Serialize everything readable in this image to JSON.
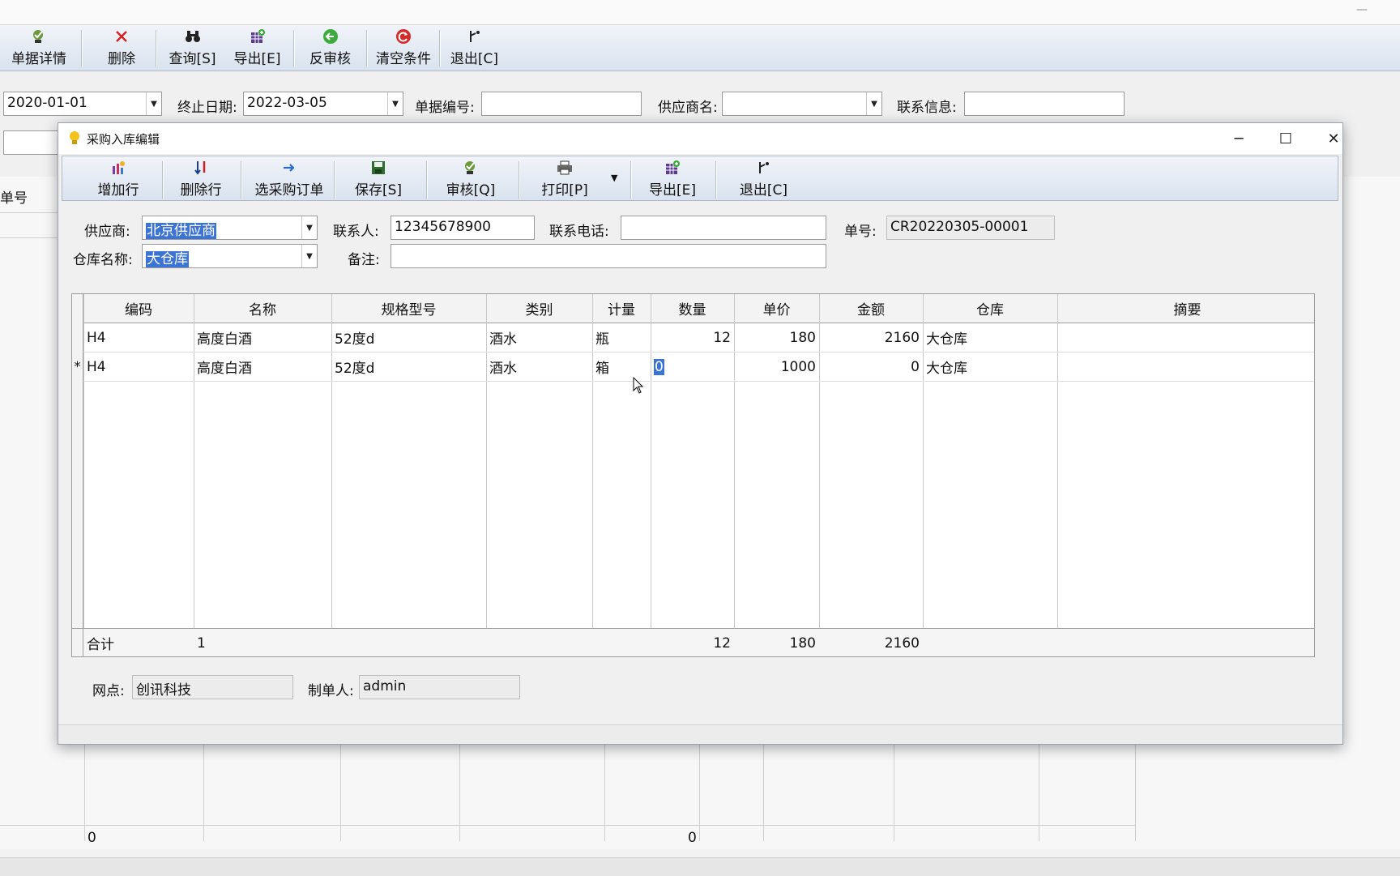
{
  "bg": {
    "toolbar": [
      {
        "label": "单据详情",
        "icon": "approve-icon"
      },
      {
        "label": "删除",
        "icon": "delete-x-icon"
      },
      {
        "label": "查询[S]",
        "icon": "binoculars-icon"
      },
      {
        "label": "导出[E]",
        "icon": "export-grid-icon"
      },
      {
        "label": "反审核",
        "icon": "green-arrow-icon"
      },
      {
        "label": "清空条件",
        "icon": "red-refresh-icon"
      },
      {
        "label": "退出[C]",
        "icon": "exit-icon"
      }
    ],
    "filters": {
      "start_date": "2020-01-01",
      "end_date_label": "终止日期:",
      "end_date": "2022-03-05",
      "doc_no_label": "单据编号:",
      "doc_no": "",
      "supplier_label": "供应商名:",
      "supplier": "",
      "contact_label": "联系信息:",
      "contact": ""
    },
    "grid_first_header": "单号",
    "footer_count": "0",
    "footer_qty": "0"
  },
  "dialog": {
    "title": "采购入库编辑",
    "toolbar": [
      {
        "label": "增加行",
        "icon": "add-row-icon"
      },
      {
        "label": "删除行",
        "icon": "sort-delete-icon"
      },
      {
        "label": "选采购订单",
        "icon": "arrow-right-icon"
      },
      {
        "label": "保存[S]",
        "icon": "save-disk-icon"
      },
      {
        "label": "审核[Q]",
        "icon": "approve-icon"
      },
      {
        "label": "打印[P]",
        "icon": "printer-icon"
      },
      {
        "label": "导出[E]",
        "icon": "export-grid-icon"
      },
      {
        "label": "退出[C]",
        "icon": "exit-icon"
      }
    ],
    "form": {
      "supplier_label": "供应商:",
      "supplier": "北京供应商",
      "contact_label": "联系人:",
      "contact": "12345678900",
      "phone_label": "联系电话:",
      "phone": "",
      "doc_label": "单号:",
      "doc": "CR20220305-00001",
      "warehouse_label": "仓库名称:",
      "warehouse": "大仓库",
      "remark_label": "备注:",
      "remark": ""
    },
    "grid": {
      "headers": [
        "编码",
        "名称",
        "规格型号",
        "类别",
        "计量",
        "数量",
        "单价",
        "金额",
        "仓库",
        "摘要"
      ],
      "rows": [
        {
          "indicator": "",
          "code": "H4",
          "name": "高度白酒",
          "spec": "52度d",
          "category": "酒水",
          "unit": "瓶",
          "qty": "12",
          "price": "180",
          "amount": "2160",
          "warehouse": "大仓库",
          "summary": ""
        },
        {
          "indicator": "*",
          "code": "H4",
          "name": "高度白酒",
          "spec": "52度d",
          "category": "酒水",
          "unit": "箱",
          "qty": "0",
          "price": "1000",
          "amount": "0",
          "warehouse": "大仓库",
          "summary": ""
        }
      ],
      "footer": {
        "label": "合计",
        "count": "1",
        "qty": "12",
        "price": "180",
        "amount": "2160"
      }
    },
    "bottom": {
      "branch_label": "网点:",
      "branch": "创讯科技",
      "maker_label": "制单人:",
      "maker": "admin"
    }
  }
}
